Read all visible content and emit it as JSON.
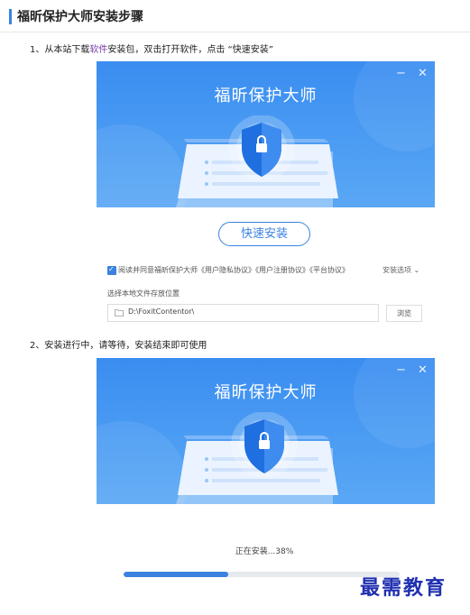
{
  "header": {
    "title": "福昕保护大师安装步骤"
  },
  "step1": {
    "prefix": "1、从本站下载",
    "link": "软件",
    "suffix": "安装包，双击打开软件，点击 “快速安装”"
  },
  "installer1": {
    "app_title": "福昕保护大师",
    "minimize": "−",
    "close": "✕",
    "quick_install": "快速安装",
    "agree_text": "阅读并同意福昕保护大师《用户隐私协议》《用户注册协议》《平台协议》",
    "options": "安装选项",
    "path_label": "选择本地文件存放位置",
    "path_value": "D:\\FoxitContentor\\",
    "browse": "浏览"
  },
  "step2": {
    "text": "2、安装进行中，请等待，安装结束即可使用"
  },
  "installer2": {
    "app_title": "福昕保护大师",
    "minimize": "−",
    "close": "✕",
    "status": "正在安装...38%",
    "progress": 0.38
  },
  "watermark": "最需教育",
  "colors": {
    "accent": "#3b82e0",
    "banner": "#4696f2",
    "watermark": "#1f2fb0"
  }
}
